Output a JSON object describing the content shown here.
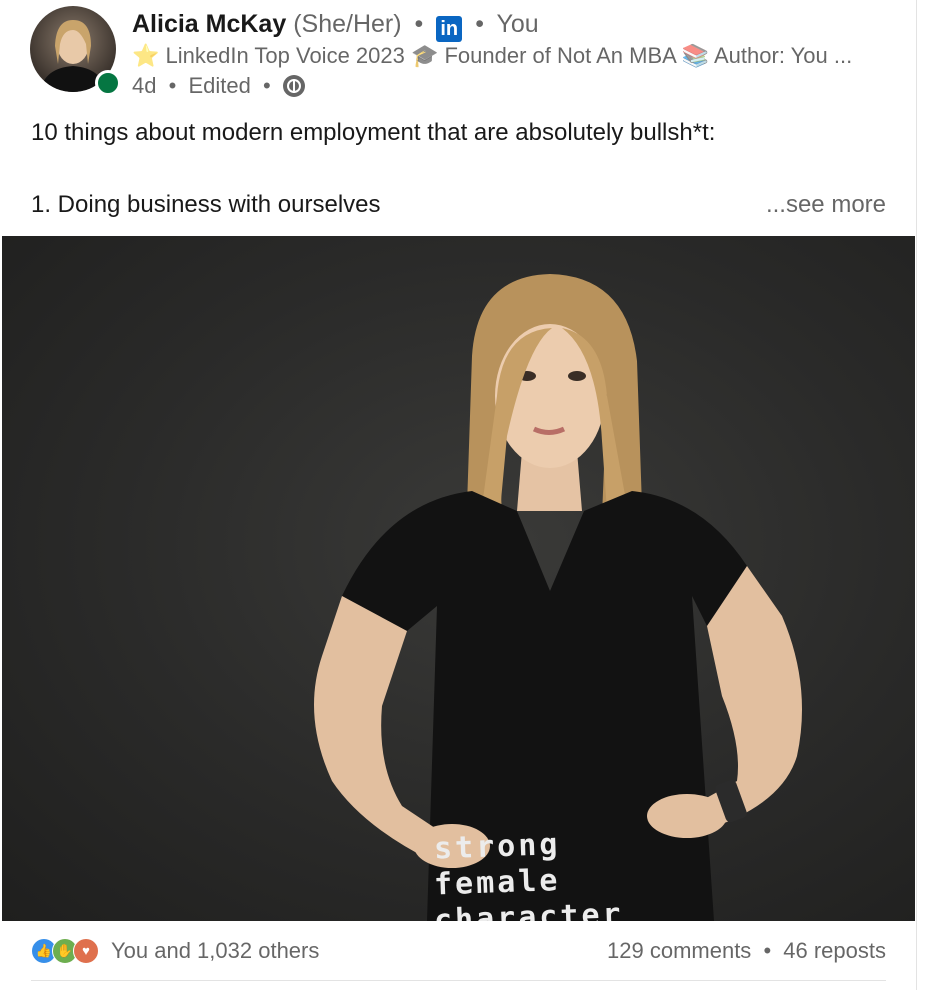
{
  "post": {
    "author": {
      "name": "Alicia McKay",
      "pronouns": "(She/Her)",
      "separator": "•",
      "badge": "in",
      "connection": "You",
      "headline": "⭐ LinkedIn Top Voice 2023 🎓 Founder of Not An MBA 📚 Author: You ...",
      "age": "4d",
      "edited": "Edited",
      "visibility_icon": "globe-icon"
    },
    "text": {
      "line1": "10 things about modern employment that are absolutely bullsh*t:",
      "line2": "1. Doing business with ourselves",
      "see_more": "...see more"
    },
    "image": {
      "shirt_lines": [
        "strong",
        "female",
        "character"
      ]
    },
    "social": {
      "reaction_icons": [
        "like-icon",
        "support-icon",
        "love-icon"
      ],
      "reactions_label": "You and 1,032 others",
      "comments": "129 comments",
      "dot": "•",
      "reposts": "46 reposts"
    }
  },
  "colors": {
    "linkedin_blue": "#0a66c2",
    "online_green": "#057642",
    "like": "#378fe9",
    "support": "#6dae4f",
    "love": "#df704d"
  }
}
